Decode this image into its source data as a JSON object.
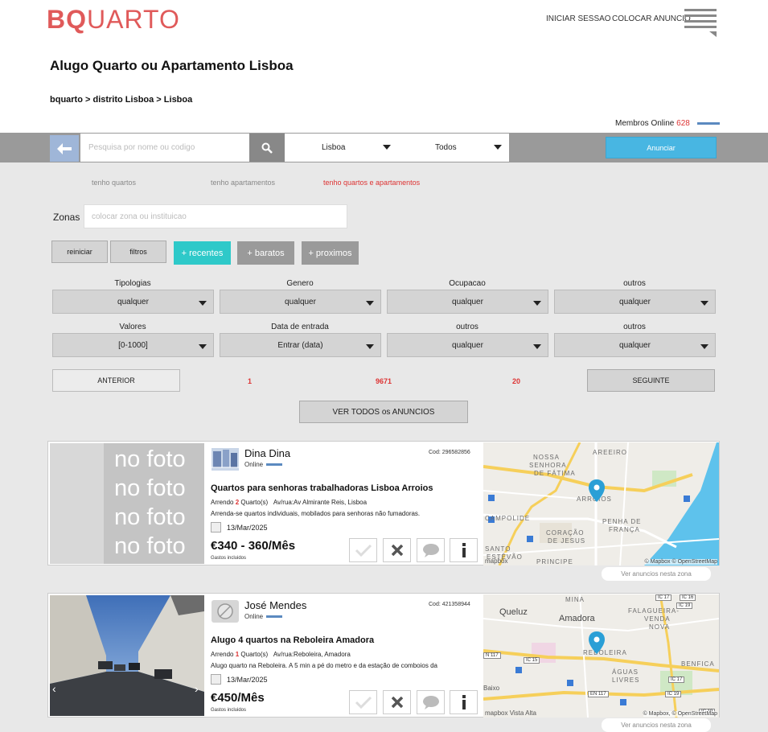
{
  "header": {
    "logo": "BQUARTO",
    "login": "INICIAR SESSAO",
    "post_ad": "COLOCAR ANUNCIO"
  },
  "page_title": "Alugo Quarto ou Apartamento Lisboa",
  "breadcrumb": "bquarto > distrito Lisboa > Lisboa",
  "members": {
    "label": "Membros Online",
    "count": "628"
  },
  "search": {
    "placeholder": "Pesquisa por nome ou codigo",
    "location": "Lisboa",
    "type": "Todos",
    "publish_label": "Anunciar"
  },
  "tabs": [
    "tenho quartos",
    "tenho apartamentos",
    "tenho quartos e apartamentos"
  ],
  "zones": {
    "label": "Zonas",
    "placeholder": "colocar zona ou instituicao"
  },
  "sort_buttons": {
    "reset": "reiniciar",
    "filters": "filtros",
    "recent": "+ recentes",
    "cheap": "+ baratos",
    "near": "+ proximos"
  },
  "filters": [
    {
      "label": "Tipologias",
      "value": "qualquer"
    },
    {
      "label": "Genero",
      "value": "qualquer"
    },
    {
      "label": "Ocupacao",
      "value": "qualquer"
    },
    {
      "label": "outros",
      "value": "qualquer"
    },
    {
      "label": "Valores",
      "value": "[0-1000]"
    },
    {
      "label": "Data de entrada",
      "value": "Entrar (data)"
    },
    {
      "label": "outros",
      "value": "qualquer"
    },
    {
      "label": "outros",
      "value": "qualquer"
    }
  ],
  "pagination": {
    "prev": "ANTERIOR",
    "page": "1",
    "total": "9671",
    "per_page": "20",
    "next": "SEGUINTE"
  },
  "view_all": "VER TODOS os ANUNCIOS",
  "listings": [
    {
      "photo_text": "no foto",
      "name": "Dina Dina",
      "status": "Online",
      "code": "Cod: 296582856",
      "title": "Quartos para senhoras trabalhadoras Lisboa Arroios",
      "rent_prefix": "Arrendo",
      "rooms": "2",
      "rooms_suffix": "Quarto(s)",
      "address": "Av/rua:Av Almirante Reis, Lisboa",
      "description": "Arrenda-se quartos individuais, mobilados para senhoras não fumadoras.",
      "date": "13/Mar/2025",
      "price": "€340 - 360/Mês",
      "expenses": "Gastos incluidos",
      "map_credit": "© Mapbox © OpenStreetMap",
      "map_logo": "mapbox",
      "map_labels": [
        "AREEIRO",
        "NOSSA",
        "SENHORA",
        "DE FÁTIMA",
        "ARROIOS",
        "CAMPOLIDE",
        "PENHA DE",
        "FRANÇA",
        "CORAÇÃO",
        "DE JESUS",
        "SANTO",
        "ESTÊVÃO",
        "PRINCIPE"
      ],
      "zone_link": "Ver anuncios nesta zona"
    },
    {
      "name": "José Mendes",
      "status": "Online",
      "code": "Cod: 421358944",
      "title": "Alugo 4 quartos na Reboleira Amadora",
      "rent_prefix": "Arrendo",
      "rooms": "1",
      "rooms_suffix": "Quarto(s)",
      "address": "Av/rua:Reboleira, Amadora",
      "description": "Alugo quarto na Reboleira. A 5 min a pé do metro e da estação de comboios da",
      "date": "13/Mar/2025",
      "price": "€450/Mês",
      "expenses": "Gastos incluidos",
      "map_credit": "© Mapbox, © OpenStreetMap",
      "map_logo": "mapbox",
      "map_extra": "Vista Alta",
      "map_labels": [
        "Queluz",
        "Amadora",
        "MINA",
        "FALAGUEIRA-",
        "VENDA",
        "NOVA",
        "REBOLEIRA",
        "Baixo",
        "ÁGUAS",
        "LIVRES",
        "BENFICA"
      ],
      "roads": [
        "IC 17",
        "IC 16",
        "IC 19",
        "N 117",
        "IC 15",
        "EN 117",
        "IC 17",
        "IC 19",
        "IC 19"
      ],
      "zone_link": "Ver anuncios nesta zona"
    }
  ],
  "colors": {
    "brand": "#e05a5a",
    "accent_red": "#dd3333",
    "cyan": "#2ec9c9",
    "blue_btn": "#48b6e2",
    "map_pin": "#2a9fd6"
  }
}
